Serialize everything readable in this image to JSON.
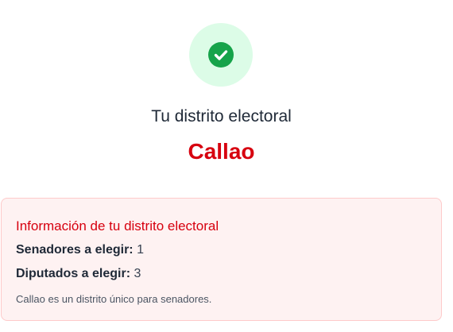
{
  "status": {
    "icon": "check-circle-icon",
    "icon_color": "#16a34a",
    "circle_color": "#dcfce7"
  },
  "district": {
    "subtitle": "Tu distrito electoral",
    "name": "Callao",
    "name_color": "#d7000f"
  },
  "info": {
    "title": "Información de tu distrito electoral",
    "senators_label": "Senadores a elegir:",
    "senators_value": "1",
    "deputies_label": "Diputados a elegir:",
    "deputies_value": "3",
    "note": "Callao es un distrito único para senadores.",
    "background_color": "#fef2f2",
    "border_color": "#fecaca"
  }
}
